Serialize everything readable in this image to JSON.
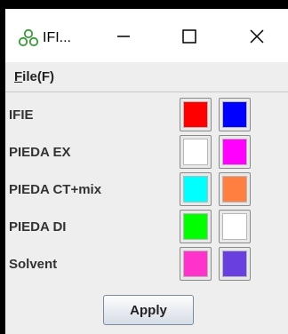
{
  "window": {
    "title": "IFI...",
    "icon": "molecule-icon"
  },
  "menu": {
    "file_label": "File(F)",
    "file_mnemonic": "F",
    "file_rest": "ile(F)"
  },
  "rows": [
    {
      "label": "IFIE",
      "color_a": "#ff0000",
      "color_b": "#0000ff"
    },
    {
      "label": "PIEDA EX",
      "color_a": "#ffffff",
      "color_b": "#ff00ff"
    },
    {
      "label": "PIEDA CT+mix",
      "color_a": "#00ffff",
      "color_b": "#ff7f40"
    },
    {
      "label": "PIEDA DI",
      "color_a": "#00ff00",
      "color_b": "#ffffff"
    },
    {
      "label": "Solvent",
      "color_a": "#ff33cc",
      "color_b": "#6a3fe0"
    }
  ],
  "apply_label": "Apply"
}
